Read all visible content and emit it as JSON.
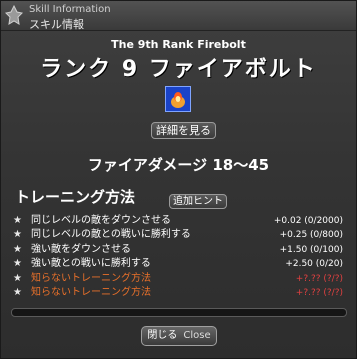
{
  "window": {
    "title_en": "Skill Information",
    "title_ja": "スキル情報",
    "icon": "skill-info-icon"
  },
  "skill": {
    "rank_en": "The 9th Rank Firebolt",
    "title": "ランク 9 ファイアボルト",
    "icon": "firebolt-icon",
    "icon_color": "#1a43c8",
    "detail_button": "詳細を見る",
    "damage": "ファイアダメージ 18～45"
  },
  "training": {
    "title": "トレーニング方法",
    "hint_button": "追加ヒント",
    "items": [
      {
        "label": "同じレベルの敵をダウンさせる",
        "value": "+0.02 (0/2000)",
        "known": true
      },
      {
        "label": "同じレベルの敵との戦いに勝利する",
        "value": "+0.25 (0/800)",
        "known": true
      },
      {
        "label": "強い敵をダウンさせる",
        "value": "+1.50 (0/100)",
        "known": true
      },
      {
        "label": "強い敵との戦いに勝利する",
        "value": "+2.50 (0/20)",
        "known": true
      },
      {
        "label": "知らないトレーニング方法",
        "value": "+?.?? (?/?)",
        "known": false
      },
      {
        "label": "知らないトレーニング方法",
        "value": "+?.?? (?/?)",
        "known": false
      }
    ],
    "progress": 0
  },
  "footer": {
    "close_ja": "閉じる",
    "close_en": "Close"
  },
  "colors": {
    "known_text": "#ffffff",
    "unknown_label": "#e8702a",
    "unknown_value": "#e04040"
  }
}
